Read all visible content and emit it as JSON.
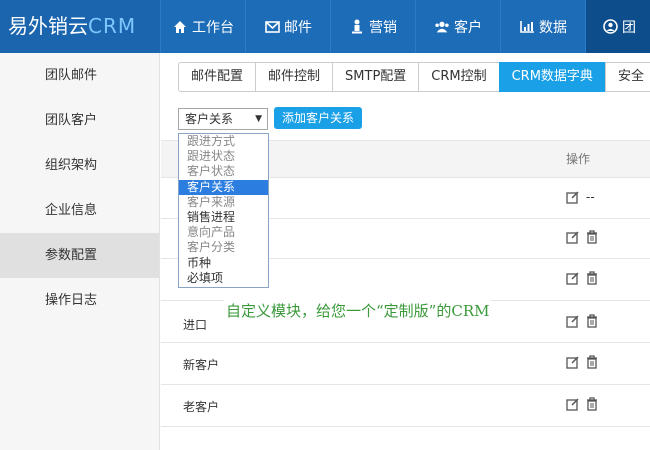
{
  "app": {
    "logo_text": "易外销云",
    "logo_suffix": "CRM"
  },
  "nav": [
    {
      "label": "工作台",
      "icon": "home-icon"
    },
    {
      "label": "邮件",
      "icon": "envelope-icon"
    },
    {
      "label": "营销",
      "icon": "person-icon"
    },
    {
      "label": "客户",
      "icon": "users-icon"
    },
    {
      "label": "数据",
      "icon": "chart-icon"
    },
    {
      "label": "团",
      "icon": "user-circle-icon",
      "active": true
    }
  ],
  "sidebar": {
    "items": [
      {
        "label": "团队邮件"
      },
      {
        "label": "团队客户"
      },
      {
        "label": "组织架构"
      },
      {
        "label": "企业信息"
      },
      {
        "label": "参数配置",
        "active": true
      },
      {
        "label": "操作日志"
      }
    ]
  },
  "tabs": [
    {
      "label": "邮件配置"
    },
    {
      "label": "邮件控制"
    },
    {
      "label": "SMTP配置"
    },
    {
      "label": "CRM控制"
    },
    {
      "label": "CRM数据字典",
      "active": true
    },
    {
      "label": "安全"
    }
  ],
  "filter": {
    "selected": "客户关系",
    "add_button": "添加客户关系",
    "options": [
      "跟进方式",
      "跟进状态",
      "客户状态",
      "客户关系",
      "客户来源",
      "销售进程",
      "意向产品",
      "客户分类",
      "币种",
      "必填项"
    ],
    "selected_index": 3
  },
  "table": {
    "header_op": "操作",
    "rows": [
      {
        "name": "",
        "deletable": false,
        "dash": "--"
      },
      {
        "name": "",
        "deletable": true
      },
      {
        "name": "",
        "deletable": true
      },
      {
        "name": "进口",
        "deletable": true
      },
      {
        "name": "新客户",
        "deletable": true
      },
      {
        "name": "老客户",
        "deletable": true
      }
    ]
  },
  "caption": "自定义模块，给您一个“定制版”的CRM",
  "colors": {
    "topbar": "#1c6cb8",
    "accent": "#1aa0e6",
    "caption": "#3a9a3a"
  }
}
